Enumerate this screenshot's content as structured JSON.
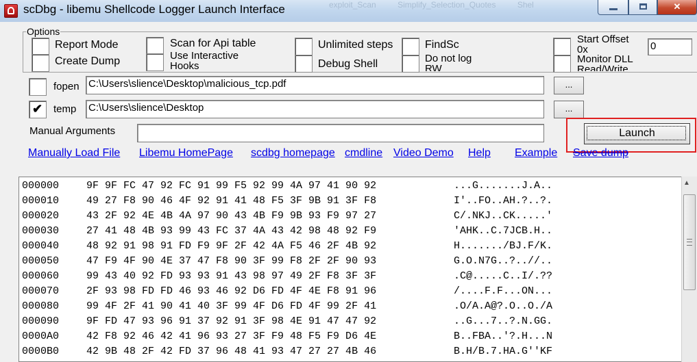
{
  "window": {
    "title": "scDbg - libemu Shellcode Logger Launch Interface",
    "background_tabs": [
      "exploit_Scan",
      "Simplify_Selection_Quotes",
      "Shel"
    ]
  },
  "options": {
    "legend": "Options",
    "report_mode": "Report Mode",
    "create_dump": "Create Dump",
    "scan_api_table": "Scan for Api table",
    "use_interactive_hooks": "Use Interactive Hooks",
    "unlimited_steps": "Unlimited steps",
    "debug_shell": "Debug Shell",
    "findsc": "FindSc",
    "do_not_log_rw": "Do not log RW",
    "start_offset": "Start Offset 0x",
    "start_offset_value": "0",
    "monitor_dll_readwrite": "Monitor DLL Read/Write"
  },
  "fopen": {
    "label": "fopen",
    "value": "C:\\Users\\slience\\Desktop\\malicious_tcp.pdf",
    "browse": "...",
    "checked": false
  },
  "temp": {
    "label": "temp",
    "value": "C:\\Users\\slience\\Desktop",
    "browse": "...",
    "checked": true
  },
  "manual_args": {
    "label": "Manual  Arguments",
    "value": ""
  },
  "launch_label": "Launch",
  "links": {
    "manually_load": "Manually Load File",
    "libemu_home": "Libemu HomePage",
    "scdbg_home": "scdbg homepage",
    "cmdline": "cmdline",
    "video_demo": "Video Demo",
    "help": "Help",
    "example": "Example",
    "save_dump": "Save dump"
  },
  "hexdump": [
    {
      "offset": "000000",
      "hex": "9F 9F FC 47 92 FC 91 99 F5 92 99 4A 97 41 90 92",
      "ascii": "...G.......J.A.."
    },
    {
      "offset": "000010",
      "hex": "49 27 F8 90 46 4F 92 91 41 48 F5 3F 9B 91 3F F8",
      "ascii": "I'..FO..AH.?..?."
    },
    {
      "offset": "000020",
      "hex": "43 2F 92 4E 4B 4A 97 90 43 4B F9 9B 93 F9 97 27",
      "ascii": "C/.NKJ..CK.....'"
    },
    {
      "offset": "000030",
      "hex": "27 41 48 4B 93 99 43 FC 37 4A 43 42 98 48 92 F9",
      "ascii": "'AHK..C.7JCB.H.."
    },
    {
      "offset": "000040",
      "hex": "48 92 91 98 91 FD F9 9F 2F 42 4A F5 46 2F 4B 92",
      "ascii": "H......./BJ.F/K."
    },
    {
      "offset": "000050",
      "hex": "47 F9 4F 90 4E 37 47 F8 90 3F 99 F8 2F 2F 90 93",
      "ascii": "G.O.N7G..?..//.."
    },
    {
      "offset": "000060",
      "hex": "99 43 40 92 FD 93 93 91 43 98 97 49 2F F8 3F 3F",
      "ascii": ".C@.....C..I/.??"
    },
    {
      "offset": "000070",
      "hex": "2F 93 98 FD FD 46 93 46 92 D6 FD 4F 4E F8 91 96",
      "ascii": "/....F.F...ON..."
    },
    {
      "offset": "000080",
      "hex": "99 4F 2F 41 90 41 40 3F 99 4F D6 FD 4F 99 2F 41",
      "ascii": ".O/A.A@?.O..O./A"
    },
    {
      "offset": "000090",
      "hex": "9F FD 47 93 96 91 37 92 91 3F 98 4E 91 47 47 92",
      "ascii": "..G...7..?.N.GG."
    },
    {
      "offset": "0000A0",
      "hex": "42 F8 92 46 42 41 96 93 27 3F F9 48 F5 F9 D6 4E",
      "ascii": "B..FBA..'?.H...N"
    },
    {
      "offset": "0000B0",
      "hex": "42 9B 48 2F 42 FD 37 96 48 41 93 47 27 27 4B 46",
      "ascii": "B.H/B.7.HA.G''KF"
    }
  ]
}
